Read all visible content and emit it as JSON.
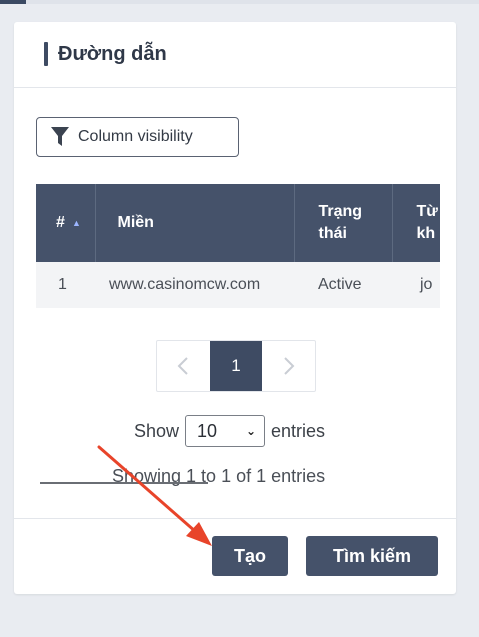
{
  "panel": {
    "title": "Đường dẫn"
  },
  "toolbar": {
    "column_visibility_label": "Column visibility",
    "filter_icon": "funnel-icon"
  },
  "table": {
    "headers": {
      "num": "#",
      "domain": "Miền",
      "status": "Trạng thái",
      "keyword": "Từ khóa"
    },
    "header_display": {
      "status_line1": "Trạng",
      "status_line2": "thái",
      "keyword_line1": "Từ",
      "keyword_line2": "kh"
    },
    "rows": [
      {
        "num": "1",
        "domain": "www.casinomcw.com",
        "status": "Active",
        "keyword": "jo"
      }
    ]
  },
  "pagination": {
    "prev_icon": "chevron-left-icon",
    "current_page": "1",
    "next_icon": "chevron-right-icon"
  },
  "length_menu": {
    "show_label": "Show",
    "selected": "10",
    "entries_label": "entries"
  },
  "info": {
    "text": "Showing 1 to 1 of 1 entries"
  },
  "actions": {
    "create_label": "Tạo",
    "search_label": "Tìm kiếm"
  },
  "annotation": {
    "arrow_color": "#e8442a"
  },
  "colors": {
    "header_bg": "#45526a",
    "button_bg": "#45526a",
    "active_page_bg": "#3e4b63"
  }
}
